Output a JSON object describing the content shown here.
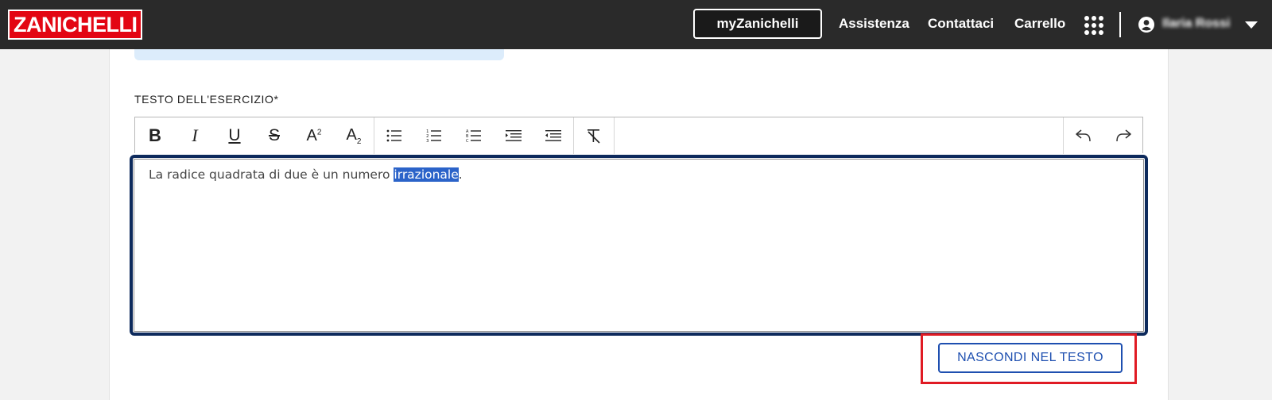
{
  "header": {
    "logo": "ZANICHELLI",
    "my_button": "myZanichelli",
    "links": [
      "Assistenza",
      "Contattaci",
      "Carrello"
    ],
    "username": "Ilaria Rossi",
    "icons": [
      "apps-grid-icon",
      "user-circle-icon",
      "caret-down-icon"
    ]
  },
  "form": {
    "field_label": "TESTO DELL'ESERCIZIO*",
    "toolbar": {
      "buttons": [
        "bold",
        "italic",
        "underline",
        "strikethrough",
        "superscript",
        "subscript",
        "bulleted-list",
        "numbered-list",
        "lettered-list",
        "indent",
        "outdent",
        "clear-format",
        "undo",
        "redo"
      ],
      "bold_glyph": "B",
      "italic_glyph": "I",
      "underline_glyph": "U",
      "strike_glyph": "S",
      "sup_glyph": "A",
      "sup_mark": "2",
      "sub_glyph": "A",
      "sub_mark": "2"
    },
    "content": {
      "before": "La radice quadrata di due è un numero ",
      "selected": "irrazionale",
      "after": "."
    },
    "hide_button": "NASCONDI NEL TESTO"
  },
  "colors": {
    "topbar": "#2a2a2a",
    "brand_red": "#e30613",
    "selection": "#2b63c9",
    "button_blue": "#1e4fb0",
    "highlight_red": "#e01b24",
    "editor_focus": "#0d2a5c"
  }
}
